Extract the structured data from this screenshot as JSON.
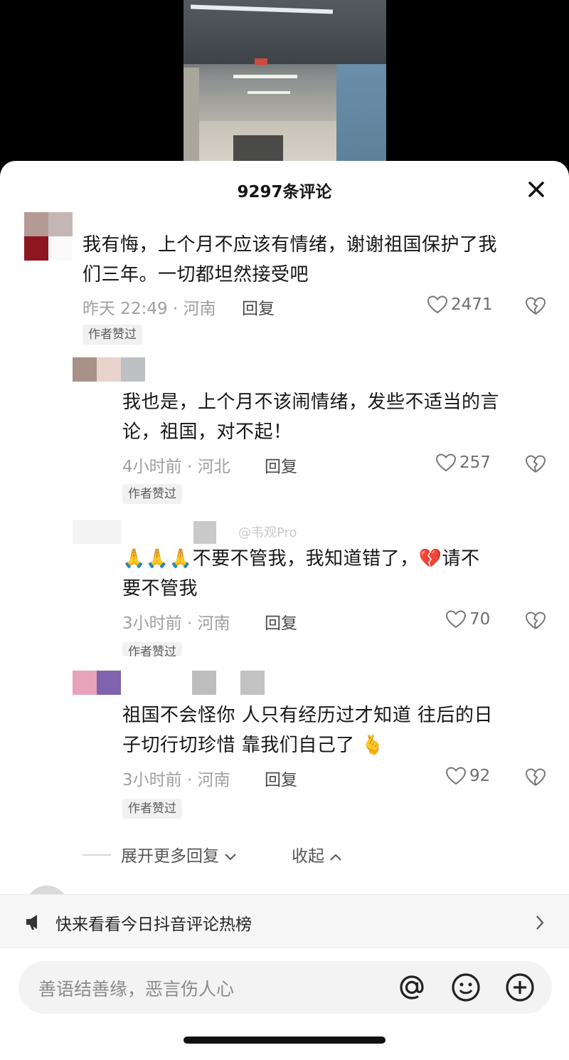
{
  "header": {
    "title": "9297条评论"
  },
  "comments": [
    {
      "text_line1": "我有悔，上个月不应该有情绪，谢谢祖国保护了我",
      "text_line2": "们三年。一切都坦然接受吧",
      "meta": "昨天 22:49 · 河南",
      "reply": "回复",
      "likes": "2471",
      "badge": "作者赞过"
    },
    {
      "text_line1": "我也是，上个月不该闹情绪，发些不适当的言",
      "text_line2": "论，祖国，对不起！",
      "meta": "4小时前 · 河北",
      "reply": "回复",
      "likes": "257",
      "badge": "作者赞过"
    },
    {
      "emoji": "🙏🙏🙏",
      "text_line1a": "不要不管我，我知道错了，",
      "emoji2": "💔",
      "text_line1b": "请不",
      "text_line2": "要不管我",
      "meta": "3小时前 · 河南",
      "reply": "回复",
      "likes": "70",
      "badge": "作者赞过"
    },
    {
      "text_line1": "祖国不会怪你  人只有经历过才知道  往后的日",
      "text_line2": "子切行切珍惜 靠我们自己了",
      "emoji": "🫰",
      "meta": "3小时前 · 河南",
      "reply": "回复",
      "likes": "92",
      "badge": "作者赞过"
    }
  ],
  "watermark": "@韦观Pro",
  "expand": {
    "more": "展开更多回复",
    "collapse": "收起"
  },
  "hot_bar": {
    "text": "快来看看今日抖音评论热榜"
  },
  "input": {
    "placeholder": "善语结善缘，恶言伤人心"
  },
  "colors": {
    "accent_text": "#161616",
    "muted": "#a0a0a0",
    "badge_bg": "#f1f1f2",
    "bar_bg": "#f6f6f7"
  }
}
